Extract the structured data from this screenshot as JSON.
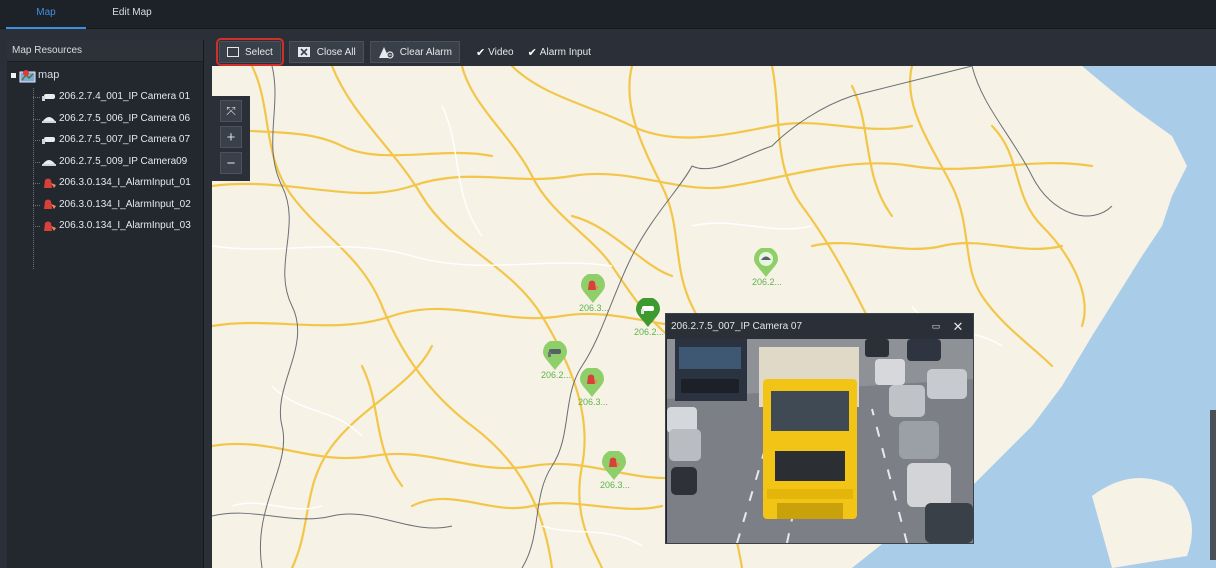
{
  "tabs": [
    {
      "label": "Map",
      "active": true
    },
    {
      "label": "Edit Map",
      "active": false
    }
  ],
  "sidebar": {
    "title": "Map Resources",
    "root": {
      "label": "map",
      "icon": "map-icon"
    },
    "items": [
      {
        "label": "206.2.7.4_001_IP Camera 01",
        "icon": "bullet-camera-icon"
      },
      {
        "label": "206.2.7.5_006_IP Camera 06",
        "icon": "dome-camera-icon"
      },
      {
        "label": "206.2.7.5_007_IP Camera 07",
        "icon": "bullet-camera-icon"
      },
      {
        "label": "206.2.7.5_009_IP Camera09",
        "icon": "dome-camera-icon"
      },
      {
        "label": "206.3.0.134_I_AlarmInput_01",
        "icon": "alarm-input-icon"
      },
      {
        "label": "206.3.0.134_I_AlarmInput_02",
        "icon": "alarm-input-icon"
      },
      {
        "label": "206.3.0.134_I_AlarmInput_03",
        "icon": "alarm-input-icon"
      }
    ]
  },
  "toolbar": {
    "select_label": "Select",
    "close_all_label": "Close All",
    "clear_alarm_label": "Clear Alarm",
    "video_label": "Video",
    "video_checked": true,
    "alarm_input_label": "Alarm Input",
    "alarm_input_checked": true
  },
  "zoom": {
    "reset_icon": "fit-icon",
    "zoom_in_icon": "plus-icon",
    "zoom_out_icon": "minus-icon"
  },
  "markers": [
    {
      "type": "dome-camera",
      "label": "206.2..."
    },
    {
      "type": "alarm-input",
      "label": "206.3..."
    },
    {
      "type": "bullet-camera",
      "label": "206.2...",
      "active": true
    },
    {
      "type": "bullet-camera",
      "label": "206.2..."
    },
    {
      "type": "alarm-input",
      "label": "206.3..."
    },
    {
      "type": "alarm-input",
      "label": "206.3..."
    }
  ],
  "popup": {
    "title": "206.2.7.5_007_IP Camera 07",
    "maximize_icon": "maximize-icon",
    "close_icon": "close-icon"
  },
  "colors": {
    "accent": "#3e8fe0",
    "marker_green": "#8ecf6a",
    "marker_active": "#3c9a2e",
    "alarm_red": "#d8403a",
    "select_highlight": "#d0302a",
    "map_road": "#f3c64a",
    "map_water": "#a9cde8"
  }
}
